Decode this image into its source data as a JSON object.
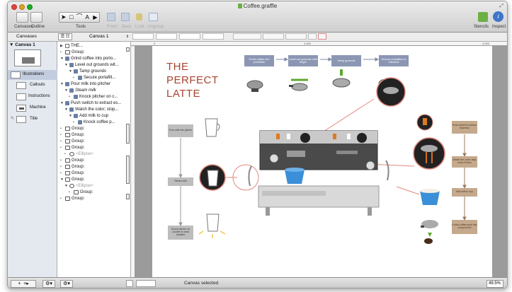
{
  "window": {
    "title": "Coffee.graffle"
  },
  "toolbar": {
    "canvases_label": "Canvases",
    "outline_label": "Outline",
    "tools_label": "Tools",
    "front_label": "Front",
    "back_label": "Back",
    "lock_label": "Lock",
    "ungroup_label": "Ungroup",
    "stencils_label": "Stencils",
    "inspect_label": "Inspect"
  },
  "rulerbar": {
    "canvases_header": "Canvases",
    "canvas_select": "Canvas 1",
    "ruler_marks": [
      "0",
      "1,000",
      "2,000"
    ]
  },
  "sidebar": {
    "canvas_name": "Canvas 1",
    "layers": [
      "Illustrations",
      "Callouts",
      "Instructions",
      "Machine",
      "Title"
    ]
  },
  "outline": {
    "rows": [
      "THE...",
      "Group:",
      "Grind coffee into porto...",
      "Level out grounds wit...",
      "Tamp grounds",
      "Secure portafilt...",
      "Pour milk into pitcher",
      "Steam milk",
      "Knock pitcher on c...",
      "Push switch to extract es...",
      "Watch the color; stop...",
      "Add milk to cup",
      "Knock coffee p...",
      "Group:",
      "Group:",
      "Group:",
      "Group:",
      "<Ellipse>",
      "Group:",
      "Group:",
      "Group:",
      "Group:",
      "<Ellipse>",
      "Group:",
      "Group:"
    ]
  },
  "diagram": {
    "title_lines": [
      "THE",
      "PERFECT",
      "LATTE"
    ],
    "top_steps": [
      "Grind coffee into portafilter",
      "Level out grounds with finger",
      "Tamp grounds",
      "Secure portafilter to machine"
    ],
    "left_steps": [
      "Pour milk into pitcher",
      "Steam milk",
      "Knock pitcher on counter to clear bubbles"
    ],
    "right_steps": [
      "Push switch to extract espresso",
      "Watch the color; stop when it thins",
      "Add milk to cup",
      "Knock coffee puck into compost bin"
    ]
  },
  "statusbar": {
    "status_text": "Canvas selected",
    "zoom": "49.5%"
  },
  "colors": {
    "title_red": "#a8432d",
    "step_blue": "#8b96b3",
    "step_brown": "#c4a98c",
    "cup_blue": "#3a8fd8",
    "callout_red": "#e08a7e"
  }
}
